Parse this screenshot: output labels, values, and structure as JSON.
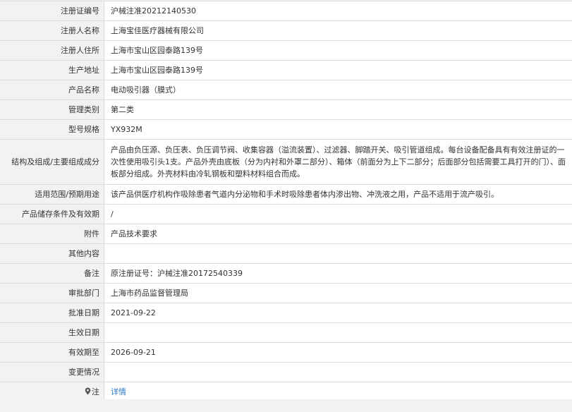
{
  "rows": [
    {
      "label": "注册证编号",
      "value": "沪械注准20212140530"
    },
    {
      "label": "注册人名称",
      "value": "上海宝佳医疗器械有限公司"
    },
    {
      "label": "注册人住所",
      "value": "上海市宝山区园泰路139号"
    },
    {
      "label": "生产地址",
      "value": "上海市宝山区园泰路139号"
    },
    {
      "label": "产品名称",
      "value": "电动吸引器（膜式）"
    },
    {
      "label": "管理类别",
      "value": "第二类"
    },
    {
      "label": "型号规格",
      "value": "YX932M"
    },
    {
      "label": "结构及组成/主要组成成分",
      "value": "产品由负压源、负压表、负压调节阀、收集容器（溢流装置）、过滤器、脚踏开关、吸引管道组成。每台设备配备具有有效注册证的一次性使用吸引头1支。产品外壳由底板（分为内衬和外罩二部分）、箱体（前面分为上下二部分；后面部分包括需要工具打开的门）、面板部分组成。外壳材料由冷轧钢板和塑料材料组合而成。"
    },
    {
      "label": "适用范围/预期用途",
      "value": "该产品供医疗机构作吸除患者气道内分泌物和手术时吸除患者体内渗出物、冲洗液之用，产品不适用于流产吸引。"
    },
    {
      "label": "产品储存条件及有效期",
      "value": "/"
    },
    {
      "label": "附件",
      "value": "产品技术要求"
    },
    {
      "label": "其他内容",
      "value": ""
    },
    {
      "label": "备注",
      "value": "原注册证号：沪械注准20172540339"
    },
    {
      "label": "审批部门",
      "value": "上海市药品监督管理局"
    },
    {
      "label": "批准日期",
      "value": "2021-09-22"
    },
    {
      "label": "生效日期",
      "value": ""
    },
    {
      "label": "有效期至",
      "value": "2026-09-21"
    },
    {
      "label": "变更情况",
      "value": ""
    }
  ],
  "note_row": {
    "label": "注",
    "link_text": "详情",
    "icon": "map-pin-icon"
  }
}
